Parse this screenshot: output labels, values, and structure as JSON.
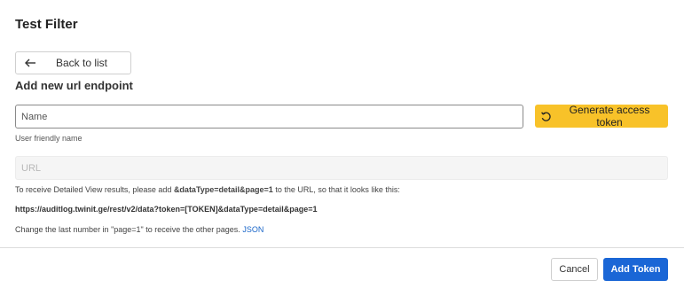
{
  "dialog": {
    "title": "Test Filter",
    "back_label": "Back to list",
    "subtitle": "Add new url endpoint"
  },
  "form": {
    "name_placeholder": "Name",
    "name_value": "",
    "name_helper": "User friendly name",
    "generate_label": "Generate access token",
    "url_placeholder": "URL",
    "url_value": ""
  },
  "info": {
    "line1_prefix": "To receive Detailed View results, please add ",
    "line1_param": "&dataType=detail&page=1",
    "line1_suffix": " to the URL, so that it looks like this:",
    "example_url": "https://auditlog.twinit.ge/rest/v2/data?token=[TOKEN]&dataType=detail&page=1",
    "line3_text": "Change the last number in \"page=1\" to receive the other pages. ",
    "line3_link": "JSON"
  },
  "footer": {
    "cancel_label": "Cancel",
    "add_label": "Add Token"
  },
  "colors": {
    "generate_button": "#f8c229",
    "primary_button": "#1a66d6",
    "link": "#1a66c9"
  },
  "icons": {
    "back": "arrow-left-icon",
    "generate": "refresh-icon"
  }
}
